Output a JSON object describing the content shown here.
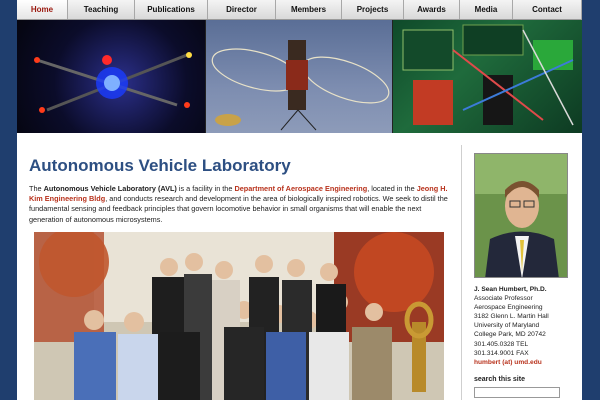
{
  "nav": {
    "items": [
      {
        "label": "Home",
        "active": true
      },
      {
        "label": "Teaching"
      },
      {
        "label": "Publications"
      },
      {
        "label": "Director"
      },
      {
        "label": "Members"
      },
      {
        "label": "Projects"
      },
      {
        "label": "Awards"
      },
      {
        "label": "Media"
      },
      {
        "label": "Contact"
      }
    ]
  },
  "main": {
    "title": "Autonomous Vehicle Laboratory",
    "intro": {
      "t1": "The ",
      "lab_name": "Autonomous Vehicle Laboratory (AVL)",
      "t2": " is a facility in the ",
      "dept_link": "Department of Aerospace Engineering",
      "t3": ", located in the ",
      "bldg_link": "Jeong H. Kim Engineering Bldg",
      "t4": ", and conducts research and development in the area of biologically inspired robotics. We seek to distil the fundamental sensing and feedback principles that govern locomotive behavior in small organisms that will enable the next generation of autonomous microsystems."
    }
  },
  "sidebar": {
    "name": "J. Sean Humbert, Ph.D.",
    "lines": [
      "Associate Professor",
      "Aerospace Engineering",
      "3182 Glenn L. Martin Hall",
      "University of Maryland",
      "College Park, MD 20742",
      "301.405.0328 TEL",
      "301.314.9001 FAX"
    ],
    "email": "humbert (at) umd.edu",
    "search_label": "search this site"
  },
  "colors": {
    "accent_link": "#b8321c",
    "title": "#2d4f82",
    "page_bg": "#1f3e6e"
  }
}
